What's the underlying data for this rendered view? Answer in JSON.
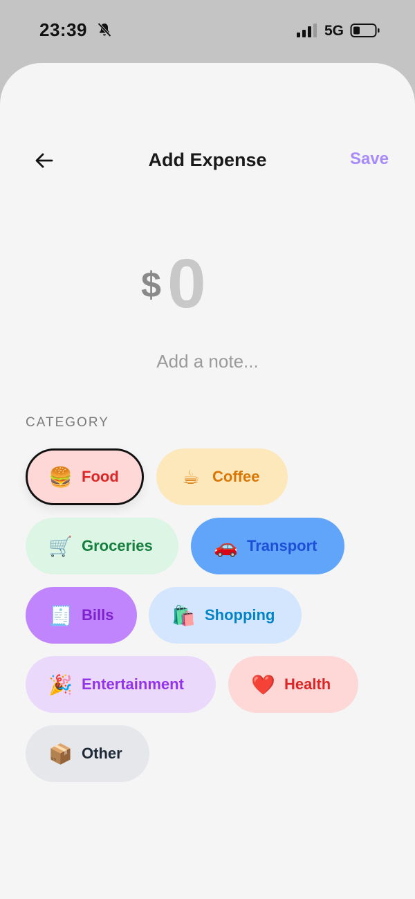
{
  "status_bar": {
    "time": "23:39",
    "network": "5G"
  },
  "header": {
    "title": "Add Expense",
    "save_label": "Save"
  },
  "amount": {
    "currency": "$",
    "value": "0"
  },
  "note": {
    "placeholder": "Add a note..."
  },
  "category_section_label": "CATEGORY",
  "categories": [
    {
      "label": "Food",
      "emoji": "🍔",
      "bg": "#fed7d7",
      "color": "#dc2626",
      "selected": true
    },
    {
      "label": "Coffee",
      "emoji": "☕",
      "bg": "#fde8bc",
      "color": "#d97706",
      "selected": false
    },
    {
      "label": "Groceries",
      "emoji": "🛒",
      "bg": "#dcf5e4",
      "color": "#15803d",
      "selected": false
    },
    {
      "label": "Transport",
      "emoji": "🚗",
      "bg": "#60a5fa",
      "color": "#1d4ed8",
      "selected": false
    },
    {
      "label": "Bills",
      "emoji": "🧾",
      "bg": "#c084fc",
      "color": "#7e22ce",
      "selected": false
    },
    {
      "label": "Shopping",
      "emoji": "🛍️",
      "bg": "#d4e6fd",
      "color": "#0284c7",
      "selected": false
    },
    {
      "label": "Entertainment",
      "emoji": "🎉",
      "bg": "#ead9fb",
      "color": "#9333ea",
      "selected": false
    },
    {
      "label": "Health",
      "emoji": "❤️",
      "bg": "#fed7d7",
      "color": "#dc2626",
      "selected": false
    },
    {
      "label": "Other",
      "emoji": "📦",
      "bg": "#e5e7eb",
      "color": "#1f2937",
      "selected": false
    }
  ]
}
